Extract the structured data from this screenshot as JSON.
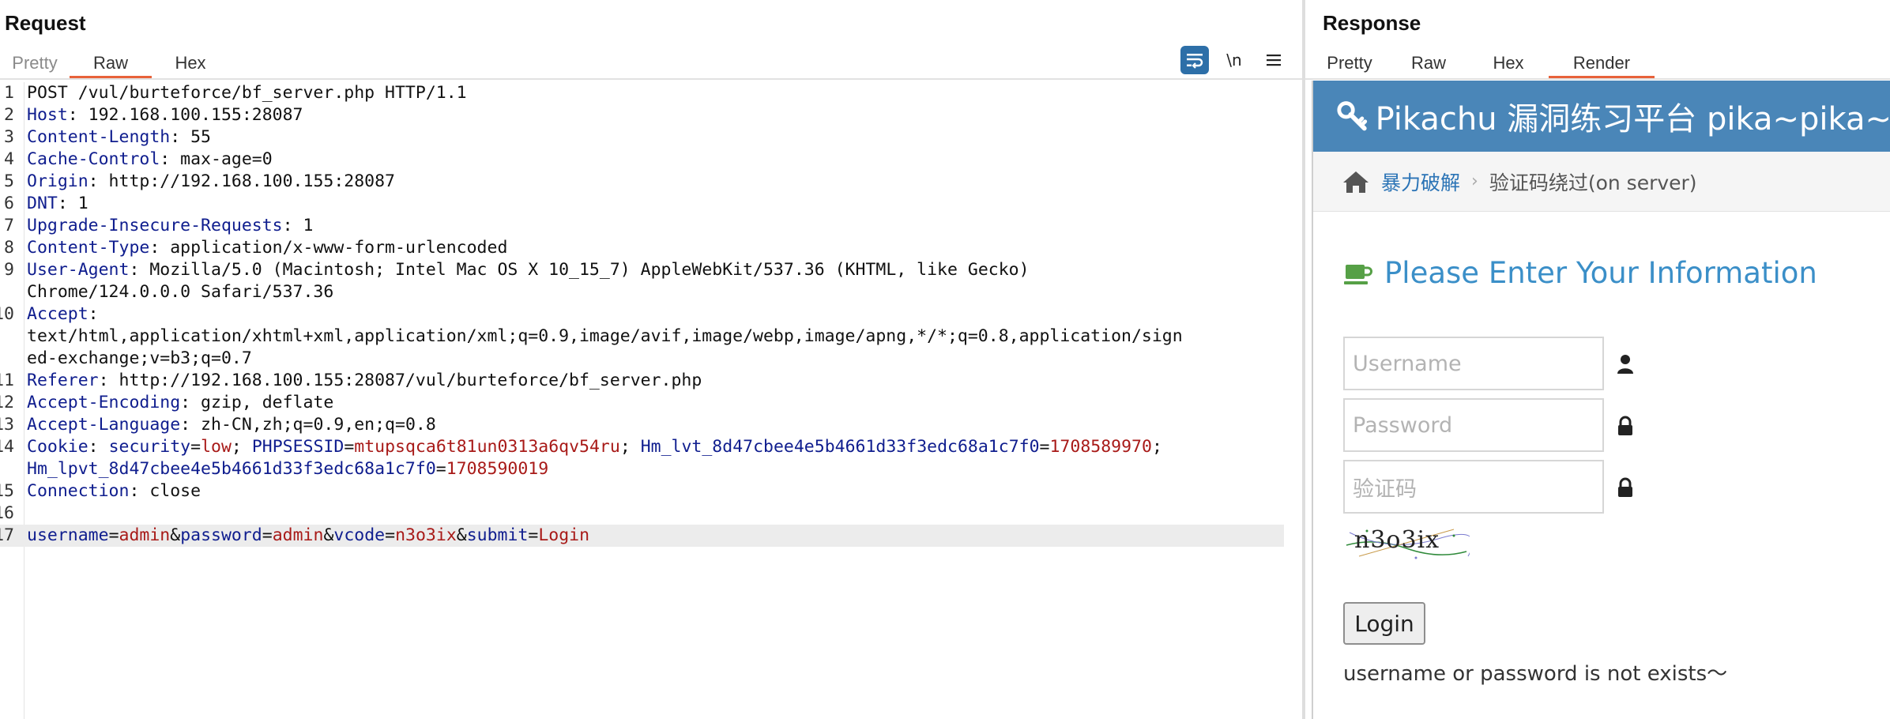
{
  "request": {
    "title": "Request",
    "tabs": [
      {
        "label": "Pretty",
        "active": false
      },
      {
        "label": "Raw",
        "active": true
      },
      {
        "label": "Hex",
        "active": false
      }
    ],
    "toolbar_icons": [
      "wrap-lines-icon",
      "newline-toggle-icon",
      "menu-icon"
    ],
    "newline_label": "\\n",
    "lines": [
      {
        "n": "1",
        "tokens": [
          {
            "t": "POST /vul/burteforce/bf_server.php HTTP/1.1",
            "c": "hv"
          }
        ]
      },
      {
        "n": "2",
        "tokens": [
          {
            "t": "Host",
            "c": "hn"
          },
          {
            "t": ": 192.168.100.155:28087",
            "c": "hv"
          }
        ]
      },
      {
        "n": "3",
        "tokens": [
          {
            "t": "Content-Length",
            "c": "hn"
          },
          {
            "t": ": 55",
            "c": "hv"
          }
        ]
      },
      {
        "n": "4",
        "tokens": [
          {
            "t": "Cache-Control",
            "c": "hn"
          },
          {
            "t": ": max-age=0",
            "c": "hv"
          }
        ]
      },
      {
        "n": "5",
        "tokens": [
          {
            "t": "Origin",
            "c": "hn"
          },
          {
            "t": ": http://192.168.100.155:28087",
            "c": "hv"
          }
        ]
      },
      {
        "n": "6",
        "tokens": [
          {
            "t": "DNT",
            "c": "hn"
          },
          {
            "t": ": 1",
            "c": "hv"
          }
        ]
      },
      {
        "n": "7",
        "tokens": [
          {
            "t": "Upgrade-Insecure-Requests",
            "c": "hn"
          },
          {
            "t": ": 1",
            "c": "hv"
          }
        ]
      },
      {
        "n": "8",
        "tokens": [
          {
            "t": "Content-Type",
            "c": "hn"
          },
          {
            "t": ": application/x-www-form-urlencoded",
            "c": "hv"
          }
        ]
      },
      {
        "n": "9",
        "tokens": [
          {
            "t": "User-Agent",
            "c": "hn"
          },
          {
            "t": ": Mozilla/5.0 (Macintosh; Intel Mac OS X 10_15_7) AppleWebKit/537.36 (KHTML, like Gecko)",
            "c": "hv"
          }
        ]
      },
      {
        "n": "",
        "tokens": [
          {
            "t": "Chrome/124.0.0.0 Safari/537.36",
            "c": "hv"
          }
        ]
      },
      {
        "n": "10",
        "tokens": [
          {
            "t": "Accept",
            "c": "hn"
          },
          {
            "t": ":",
            "c": "hv"
          }
        ]
      },
      {
        "n": "",
        "tokens": [
          {
            "t": "text/html,application/xhtml+xml,application/xml;q=0.9,image/avif,image/webp,image/apng,*/*;q=0.8,application/sign",
            "c": "hv"
          }
        ]
      },
      {
        "n": "",
        "tokens": [
          {
            "t": "ed-exchange;v=b3;q=0.7",
            "c": "hv"
          }
        ]
      },
      {
        "n": "11",
        "tokens": [
          {
            "t": "Referer",
            "c": "hn"
          },
          {
            "t": ": http://192.168.100.155:28087/vul/burteforce/bf_server.php",
            "c": "hv"
          }
        ]
      },
      {
        "n": "12",
        "tokens": [
          {
            "t": "Accept-Encoding",
            "c": "hn"
          },
          {
            "t": ": gzip, deflate",
            "c": "hv"
          }
        ]
      },
      {
        "n": "13",
        "tokens": [
          {
            "t": "Accept-Language",
            "c": "hn"
          },
          {
            "t": ": zh-CN,zh;q=0.9,en;q=0.8",
            "c": "hv"
          }
        ]
      },
      {
        "n": "14",
        "tokens": [
          {
            "t": "Cookie",
            "c": "hn"
          },
          {
            "t": ": ",
            "c": "hv"
          },
          {
            "t": "security",
            "c": "pk"
          },
          {
            "t": "=",
            "c": "pe"
          },
          {
            "t": "low",
            "c": "pv"
          },
          {
            "t": "; ",
            "c": "pe"
          },
          {
            "t": "PHPSESSID",
            "c": "pk"
          },
          {
            "t": "=",
            "c": "pe"
          },
          {
            "t": "mtupsqca6t81un0313a6qv54ru",
            "c": "pv"
          },
          {
            "t": "; ",
            "c": "pe"
          },
          {
            "t": "Hm_lvt_8d47cbee4e5b4661d33f3edc68a1c7f0",
            "c": "pk"
          },
          {
            "t": "=",
            "c": "pe"
          },
          {
            "t": "1708589970",
            "c": "pv"
          },
          {
            "t": ";",
            "c": "pe"
          }
        ]
      },
      {
        "n": "",
        "tokens": [
          {
            "t": "Hm_lpvt_8d47cbee4e5b4661d33f3edc68a1c7f0",
            "c": "pk"
          },
          {
            "t": "=",
            "c": "pe"
          },
          {
            "t": "1708590019",
            "c": "pv"
          }
        ]
      },
      {
        "n": "15",
        "tokens": [
          {
            "t": "Connection",
            "c": "hn"
          },
          {
            "t": ": close",
            "c": "hv"
          }
        ]
      },
      {
        "n": "16",
        "tokens": []
      },
      {
        "n": "17",
        "highlighted": true,
        "tokens": [
          {
            "t": "username",
            "c": "pk"
          },
          {
            "t": "=",
            "c": "pe"
          },
          {
            "t": "admin",
            "c": "pv"
          },
          {
            "t": "&",
            "c": "pe"
          },
          {
            "t": "password",
            "c": "pk"
          },
          {
            "t": "=",
            "c": "pe"
          },
          {
            "t": "admin",
            "c": "pv"
          },
          {
            "t": "&",
            "c": "pe"
          },
          {
            "t": "vcode",
            "c": "pk"
          },
          {
            "t": "=",
            "c": "pe"
          },
          {
            "t": "n3o3ix",
            "c": "pv"
          },
          {
            "t": "&",
            "c": "pe"
          },
          {
            "t": "submit",
            "c": "pk"
          },
          {
            "t": "=",
            "c": "pe"
          },
          {
            "t": "Login",
            "c": "pv"
          }
        ]
      }
    ]
  },
  "response": {
    "title": "Response",
    "tabs": [
      {
        "label": "Pretty",
        "active": false
      },
      {
        "label": "Raw",
        "active": false
      },
      {
        "label": "Hex",
        "active": false
      },
      {
        "label": "Render",
        "active": true
      }
    ],
    "render": {
      "header_title": "Pikachu 漏洞练习平台 pika~pika~",
      "breadcrumb": {
        "link": "暴力破解",
        "separator": "›",
        "current": "验证码绕过(on server)"
      },
      "form_title": "Please Enter Your Information",
      "username_placeholder": "Username",
      "password_placeholder": "Password",
      "vcode_placeholder": "验证码",
      "captcha_text": "n3o3ix",
      "login_label": "Login",
      "message": "username or password is not exists～"
    }
  },
  "colors": {
    "accent": "#e8623a",
    "header_key": "#0f1d8e",
    "param_value": "#a81a18",
    "pikachu_header": "#4a86b8",
    "link": "#2b74b6"
  }
}
